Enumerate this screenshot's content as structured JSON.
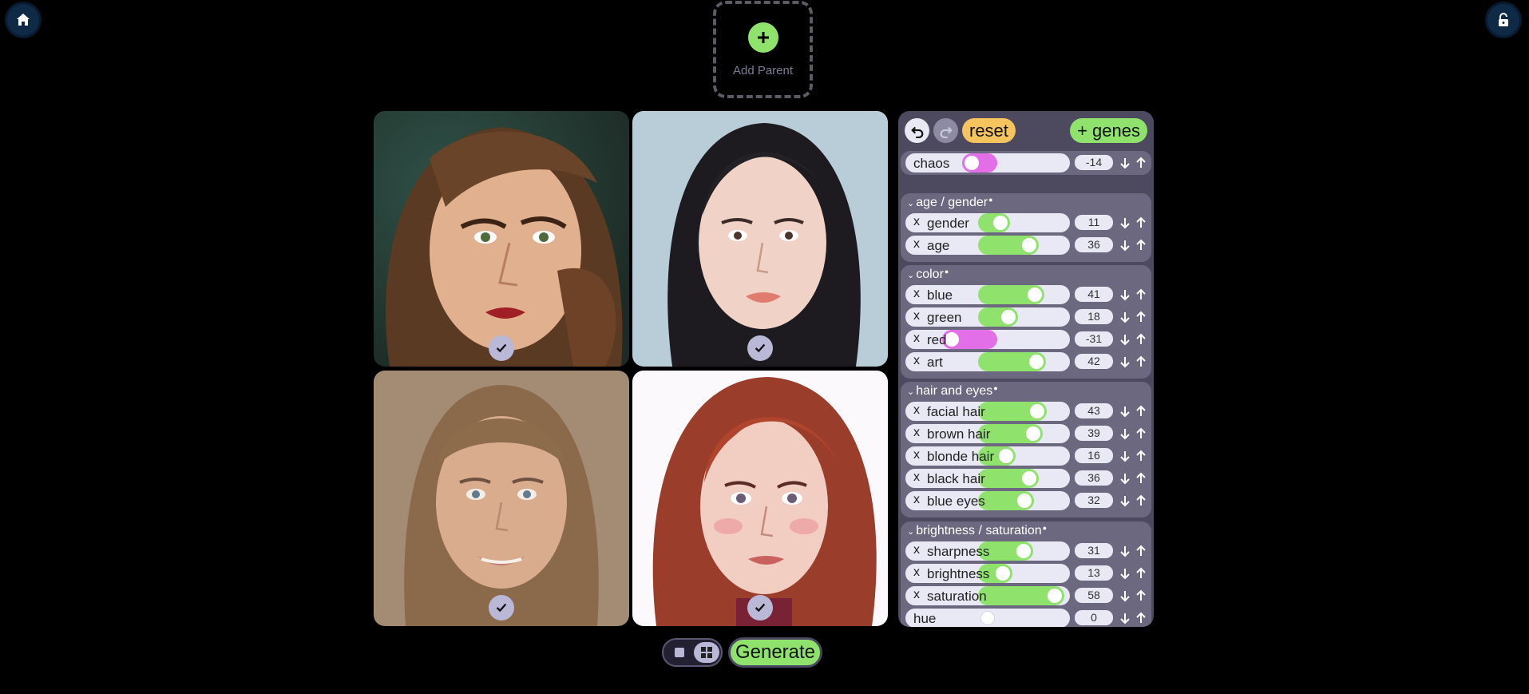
{
  "top_bar": {
    "home_icon": "home-icon",
    "lock_icon": "unlock-icon",
    "add_parent_label": "Add Parent"
  },
  "images": [
    {
      "id": 1,
      "selected": true,
      "style": "painted portrait, wavy brown hair, green eyes, red lips"
    },
    {
      "id": 2,
      "selected": true,
      "style": "painted portrait, straight black hair, light blue background"
    },
    {
      "id": 3,
      "selected": true,
      "style": "photo portrait, light brown hair, smiling"
    },
    {
      "id": 4,
      "selected": true,
      "style": "illustrated portrait, red hair, white background"
    }
  ],
  "panel": {
    "reset_label": "reset",
    "genes_label": "+ genes",
    "chaos": {
      "label": "chaos",
      "value": "-14",
      "level": -14
    },
    "groups": [
      {
        "title": "age / gender",
        "rows": [
          {
            "label": "gender",
            "value": "11",
            "level": 11
          },
          {
            "label": "age",
            "value": "36",
            "level": 36
          }
        ]
      },
      {
        "title": "color",
        "rows": [
          {
            "label": "blue",
            "value": "41",
            "level": 41
          },
          {
            "label": "green",
            "value": "18",
            "level": 18
          },
          {
            "label": "red",
            "value": "-31",
            "level": -31
          },
          {
            "label": "art",
            "value": "42",
            "level": 42
          }
        ]
      },
      {
        "title": "hair and eyes",
        "rows": [
          {
            "label": "facial hair",
            "value": "43",
            "level": 43
          },
          {
            "label": "brown hair",
            "value": "39",
            "level": 39
          },
          {
            "label": "blonde hair",
            "value": "16",
            "level": 16
          },
          {
            "label": "black hair",
            "value": "36",
            "level": 36
          },
          {
            "label": "blue eyes",
            "value": "32",
            "level": 32
          }
        ]
      },
      {
        "title": "brightness / saturation",
        "rows": [
          {
            "label": "sharpness",
            "value": "31",
            "level": 31
          },
          {
            "label": "brightness",
            "value": "13",
            "level": 13
          },
          {
            "label": "saturation",
            "value": "58",
            "level": 58
          },
          {
            "label": "hue",
            "value": "0",
            "level": 0,
            "removable": false
          }
        ]
      }
    ],
    "colors": {
      "positive": "#8fe36d",
      "negative": "#e36fe8",
      "track": "#e9e8f5"
    }
  },
  "bottom_bar": {
    "generate_label": "Generate"
  }
}
